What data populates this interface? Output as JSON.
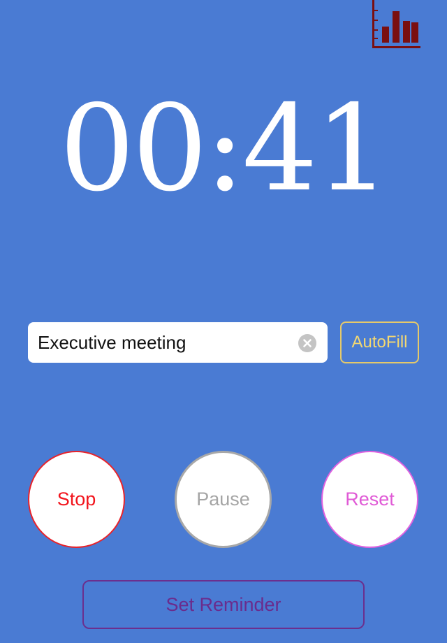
{
  "header": {
    "stats_icon": "bar-chart-icon",
    "stats_icon_color": "#7a0f10"
  },
  "timer": {
    "display": "00:41"
  },
  "task": {
    "value": "Executive meeting",
    "clear_icon": "clear-x-icon",
    "autofill_label": "AutoFill"
  },
  "controls": {
    "stop_label": "Stop",
    "pause_label": "Pause",
    "reset_label": "Reset",
    "stop_color": "#f2141c",
    "pause_color": "#a5a5a5",
    "reset_color": "#e05ad6"
  },
  "reminder": {
    "label": "Set Reminder",
    "color": "#6a2c8d"
  },
  "theme": {
    "background": "#4a7bd3",
    "autofill_color": "#f3d872"
  }
}
